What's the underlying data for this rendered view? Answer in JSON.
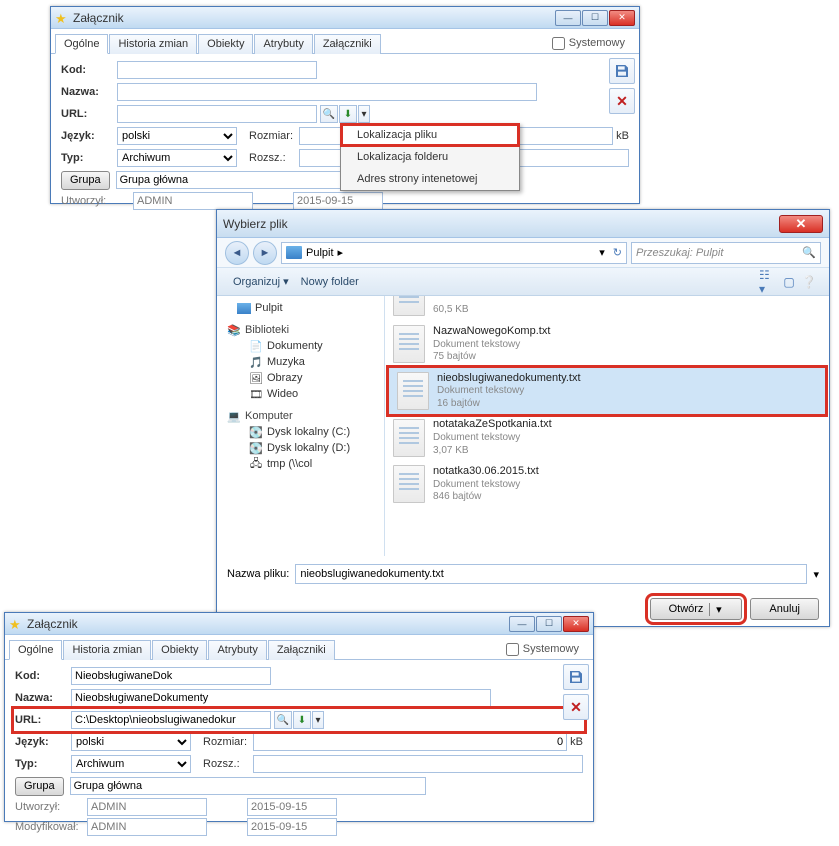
{
  "win1": {
    "title": "Załącznik",
    "tabs": [
      "Ogólne",
      "Historia zmian",
      "Obiekty",
      "Atrybuty",
      "Załączniki"
    ],
    "systemowy": "Systemowy",
    "labels": {
      "kod": "Kod:",
      "nazwa": "Nazwa:",
      "url": "URL:",
      "jezyk": "Język:",
      "typ": "Typ:",
      "rozmiar": "Rozmiar:",
      "rozsz": "Rozsz.:",
      "grupa": "Grupa",
      "utworzyl": "Utworzył:"
    },
    "values": {
      "kod": "",
      "nazwa": "",
      "url": "",
      "jezyk": "polski",
      "typ": "Archiwum",
      "rozmiar": "",
      "kB": "kB",
      "rozsz": "",
      "grupa": "Grupa główna",
      "utworzyl_user": "ADMIN",
      "utworzyl_date": "2015-09-15"
    },
    "context": {
      "item1": "Lokalizacja pliku",
      "item2": "Lokalizacja folderu",
      "item3": "Adres strony intenetowej"
    }
  },
  "filedlg": {
    "title": "Wybierz plik",
    "crumb": "Pulpit",
    "search_ph": "Przeszukaj: Pulpit",
    "toolbar": {
      "org": "Organizuj",
      "newf": "Nowy folder"
    },
    "tree": {
      "pulpit": "Pulpit",
      "biblioteki": "Biblioteki",
      "dokumenty": "Dokumenty",
      "muzyka": "Muzyka",
      "obrazy": "Obrazy",
      "wideo": "Wideo",
      "komputer": "Komputer",
      "c": "Dysk lokalny (C:)",
      "d": "Dysk lokalny (D:)",
      "tmp": "tmp (\\\\col"
    },
    "files": {
      "f0_size": "60,5 KB",
      "f1_name": "NazwaNowegoKomp.txt",
      "f1_sub": "Dokument tekstowy",
      "f1_size": "75 bajtów",
      "f2_name": "nieobslugiwanedokumenty.txt",
      "f2_sub": "Dokument tekstowy",
      "f2_size": "16 bajtów",
      "f3_name": "notatakaZeSpotkania.txt",
      "f3_sub": "Dokument tekstowy",
      "f3_size": "3,07 KB",
      "f4_name": "notatka30.06.2015.txt",
      "f4_sub": "Dokument tekstowy",
      "f4_size": "846 bajtów"
    },
    "filename_label": "Nazwa pliku:",
    "filename_value": "nieobslugiwanedokumenty.txt",
    "open": "Otwórz",
    "cancel": "Anuluj"
  },
  "win2": {
    "title": "Załącznik",
    "tabs": [
      "Ogólne",
      "Historia zmian",
      "Obiekty",
      "Atrybuty",
      "Załączniki"
    ],
    "systemowy": "Systemowy",
    "labels": {
      "kod": "Kod:",
      "nazwa": "Nazwa:",
      "url": "URL:",
      "jezyk": "Język:",
      "typ": "Typ:",
      "rozmiar": "Rozmiar:",
      "rozsz": "Rozsz.:",
      "grupa": "Grupa",
      "utworzyl": "Utworzył:",
      "modyfikowal": "Modyfikował:"
    },
    "values": {
      "kod": "NieobsługiwaneDok",
      "nazwa": "NieobsługiwaneDokumenty",
      "url": "C:\\Desktop\\nieobslugiwanedokur",
      "jezyk": "polski",
      "typ": "Archiwum",
      "rozmiar": "0",
      "kB": "kB",
      "rozsz": "",
      "grupa": "Grupa główna",
      "utworzyl_user": "ADMIN",
      "utworzyl_date": "2015-09-15",
      "mod_user": "ADMIN",
      "mod_date": "2015-09-15"
    }
  }
}
